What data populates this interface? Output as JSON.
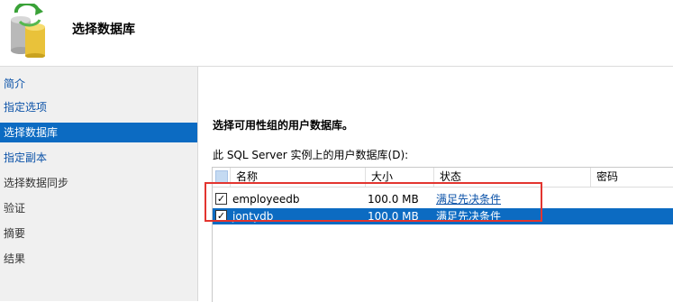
{
  "header": {
    "title": "选择数据库",
    "icon": "database-sync-icon"
  },
  "sidebar": {
    "items": [
      {
        "label": "简介",
        "state": "link"
      },
      {
        "label": "指定选项",
        "state": "link"
      },
      {
        "label": "选择数据库",
        "state": "active"
      },
      {
        "label": "指定副本",
        "state": "link"
      },
      {
        "label": "选择数据同步",
        "state": "muted"
      },
      {
        "label": "验证",
        "state": "muted"
      },
      {
        "label": "摘要",
        "state": "muted"
      },
      {
        "label": "结果",
        "state": "muted"
      }
    ]
  },
  "main": {
    "section_title": "选择可用性组的用户数据库。",
    "list_label": "此 SQL Server 实例上的用户数据库(D):",
    "grid": {
      "columns": [
        "名称",
        "大小",
        "状态",
        "密码"
      ],
      "rows": [
        {
          "checked": true,
          "name": "employeedb",
          "size": "100.0 MB",
          "status": "满足先决条件",
          "password": "",
          "selected": false
        },
        {
          "checked": true,
          "name": "jontydb",
          "size": "100.0 MB",
          "status": "满足先决条件",
          "password": "",
          "selected": true
        }
      ]
    }
  },
  "colors": {
    "accent": "#0c6bc2",
    "link": "#0b52a8",
    "highlight": "#e3352f"
  }
}
